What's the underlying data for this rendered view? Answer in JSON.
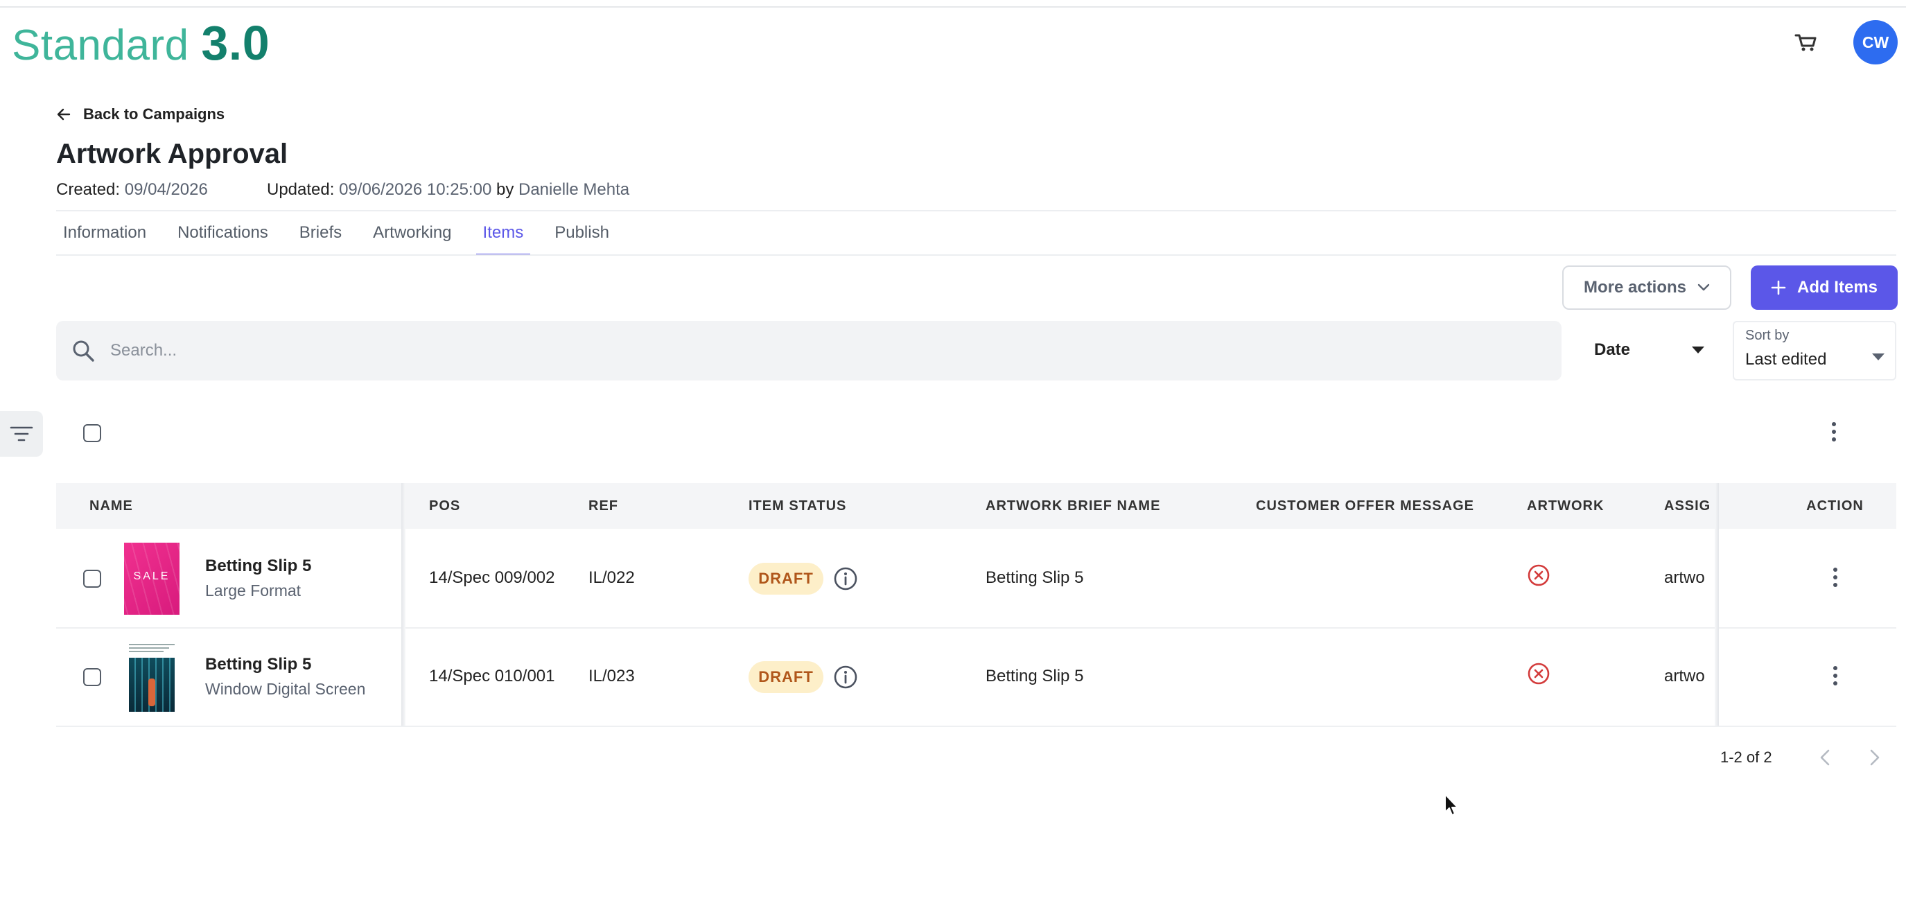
{
  "app": {
    "logo_light": "Standard ",
    "logo_bold": "3.0"
  },
  "header": {
    "cart_icon": "cart-icon",
    "avatar_initials": "CW"
  },
  "nav": {
    "back_label": "Back to Campaigns"
  },
  "page": {
    "title": "Artwork Approval",
    "created_label": "Created:",
    "created_value": "09/04/2026",
    "updated_label": "Updated:",
    "updated_value": "09/06/2026 10:25:00",
    "by_label": "by",
    "updated_by": "Danielle Mehta"
  },
  "tabs": [
    {
      "label": "Information",
      "active": false
    },
    {
      "label": "Notifications",
      "active": false
    },
    {
      "label": "Briefs",
      "active": false
    },
    {
      "label": "Artworking",
      "active": false
    },
    {
      "label": "Items",
      "active": true
    },
    {
      "label": "Publish",
      "active": false
    }
  ],
  "toolbar": {
    "more_actions": "More actions",
    "add_items": "Add Items"
  },
  "search": {
    "placeholder": "Search..."
  },
  "date_filter": {
    "value": "Date"
  },
  "sort": {
    "label": "Sort by",
    "value": "Last edited"
  },
  "table": {
    "headers": {
      "name": "NAME",
      "pos": "POS",
      "ref": "REF",
      "status": "ITEM STATUS",
      "brief": "ARTWORK BRIEF NAME",
      "offer": "CUSTOMER OFFER MESSAGE",
      "artwork": "ARTWORK",
      "assignee": "ASSIG",
      "action": "ACTION"
    },
    "rows": [
      {
        "name": "Betting Slip 5",
        "format": "Large Format",
        "pos": "14/Spec 009/002",
        "ref": "IL/022",
        "status": "DRAFT",
        "brief": "Betting Slip 5",
        "offer": "",
        "artwork_icon": "x-circle-icon",
        "assignee": "artwo",
        "thumb_text": "SALE"
      },
      {
        "name": "Betting Slip 5",
        "format": "Window Digital Screen",
        "pos": "14/Spec 010/001",
        "ref": "IL/023",
        "status": "DRAFT",
        "brief": "Betting Slip 5",
        "offer": "",
        "artwork_icon": "x-circle-icon",
        "assignee": "artwo",
        "thumb_text": ""
      }
    ]
  },
  "pagination": {
    "range": "1-2 of 2"
  },
  "colors": {
    "accent": "#5b57e8",
    "brand_light": "#3fb59a",
    "brand_dark": "#13806c",
    "draft_bg": "#fdefc9",
    "draft_text": "#b0561a",
    "error": "#d33b3b"
  }
}
